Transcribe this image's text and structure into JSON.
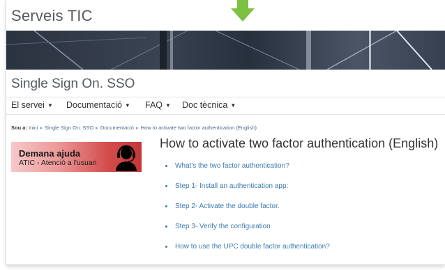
{
  "site": {
    "title": "Serveis TIC"
  },
  "section": {
    "title": "Single Sign On. SSO"
  },
  "nav": {
    "items": [
      {
        "label": "El servei"
      },
      {
        "label": "Documentació"
      },
      {
        "label": "FAQ"
      },
      {
        "label": "Doc tècnica"
      }
    ]
  },
  "breadcrumb": {
    "prefix": "Sou a:",
    "items": [
      "Inici",
      "Single Sign On. SSO",
      "Documentació",
      "How to activate two factor authentication (English)"
    ]
  },
  "help": {
    "title": "Demana ajuda",
    "subtitle": "ATIC - Atenció a l'usuari"
  },
  "page": {
    "heading": "How to activate two factor authentication (English)"
  },
  "toc": {
    "items": [
      "What's the two factor authentication?",
      "Step 1- Install an authentication app:",
      "Step 2- Activate the double factor.",
      "Step 3- Verify the configuration",
      "How to use the UPC double factor authentication?"
    ]
  },
  "colors": {
    "arrow": "#7cc142",
    "link": "#3a7ab0",
    "help_box": "#d24b4b"
  },
  "icons": {
    "arrow": "arrow-down-icon",
    "headset": "headset-agent-icon",
    "caret": "caret-down-icon"
  }
}
